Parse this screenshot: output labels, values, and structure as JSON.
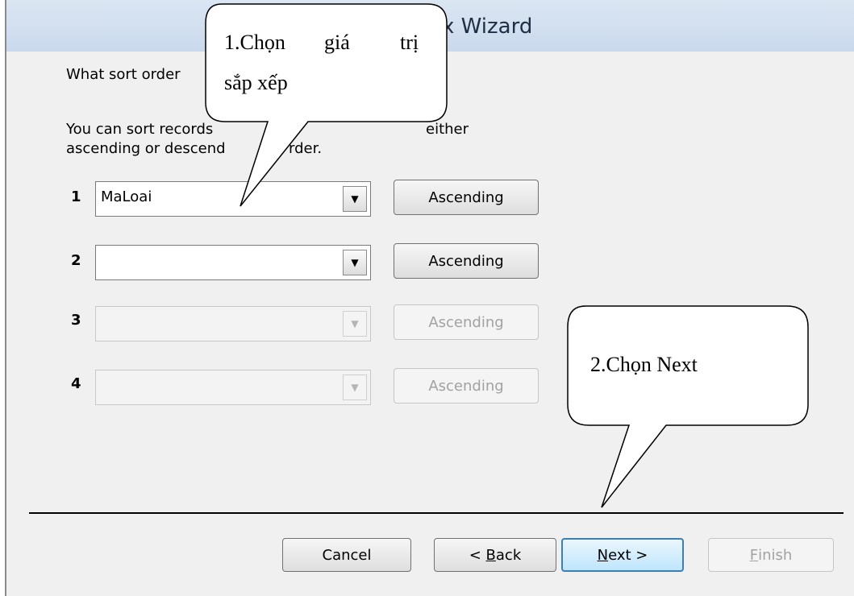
{
  "dialog": {
    "title": "x Wizard",
    "question": "What sort order",
    "help_line1": "You can sort records",
    "help_line1_tail": "either",
    "help_line2": "ascending or descend",
    "help_line2_tail": "rder."
  },
  "sort_fields": [
    {
      "number": "1",
      "value": "MaLoai",
      "order": "Ascending",
      "enabled": true
    },
    {
      "number": "2",
      "value": "",
      "order": "Ascending",
      "enabled": true
    },
    {
      "number": "3",
      "value": "",
      "order": "Ascending",
      "enabled": false
    },
    {
      "number": "4",
      "value": "",
      "order": "Ascending",
      "enabled": false
    }
  ],
  "buttons": {
    "cancel": "Cancel",
    "back_prefix": "< ",
    "back_key": "B",
    "back_rest": "ack",
    "next_key": "N",
    "next_rest": "ext >",
    "finish_key": "F",
    "finish_rest": "inish"
  },
  "callouts": {
    "first_line1": [
      "1.Chọn",
      "giá",
      "trị"
    ],
    "first_line2": "sắp xếp",
    "second": "2.Chọn Next"
  }
}
